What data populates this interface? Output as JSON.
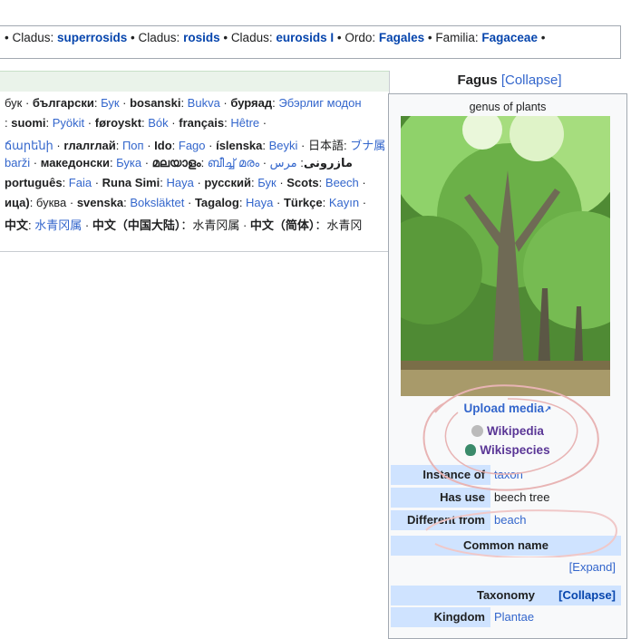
{
  "taxbar": {
    "items": [
      {
        "label": "Cladus",
        "value": "superrosids"
      },
      {
        "label": "Cladus",
        "value": "rosids"
      },
      {
        "label": "Cladus",
        "value": "eurosids I"
      },
      {
        "label": "Ordo",
        "value": "Fagales"
      },
      {
        "label": "Familia",
        "value": "Fagaceae"
      }
    ],
    "sep": " • ",
    "colon": ": "
  },
  "languages": {
    "lines": [
      [
        {
          "t": "бук",
          "c": "n"
        },
        {
          "t": " · ",
          "c": "n"
        },
        {
          "t": "български",
          "c": "b"
        },
        {
          "t": ": ",
          "c": "n"
        },
        {
          "t": "Бук",
          "c": "l"
        },
        {
          "t": " · ",
          "c": "n"
        },
        {
          "t": "bosanski",
          "c": "b"
        },
        {
          "t": ": ",
          "c": "n"
        },
        {
          "t": "Bukva",
          "c": "l"
        },
        {
          "t": " · ",
          "c": "n"
        },
        {
          "t": "буряад",
          "c": "b"
        },
        {
          "t": ": ",
          "c": "n"
        },
        {
          "t": "Эбэрлиг модон",
          "c": "l"
        }
      ],
      [
        {
          "t": ": ",
          "c": "n"
        },
        {
          "t": "suomi",
          "c": "b"
        },
        {
          "t": ": ",
          "c": "n"
        },
        {
          "t": "Pyökit",
          "c": "l"
        },
        {
          "t": " · ",
          "c": "n"
        },
        {
          "t": "føroyskt",
          "c": "b"
        },
        {
          "t": ": ",
          "c": "n"
        },
        {
          "t": "Bók",
          "c": "l"
        },
        {
          "t": " · ",
          "c": "n"
        },
        {
          "t": "français",
          "c": "b"
        },
        {
          "t": ": ",
          "c": "n"
        },
        {
          "t": "Hêtre",
          "c": "l"
        },
        {
          "t": " ·",
          "c": "n"
        }
      ],
      [
        {
          "t": "ճարենի",
          "c": "l"
        },
        {
          "t": " · ",
          "c": "n"
        },
        {
          "t": "rлaлrлай",
          "c": "b"
        },
        {
          "t": ": ",
          "c": "n"
        },
        {
          "t": "Поп",
          "c": "l"
        },
        {
          "t": " · ",
          "c": "n"
        },
        {
          "t": "Ido",
          "c": "b"
        },
        {
          "t": ": ",
          "c": "n"
        },
        {
          "t": "Fago",
          "c": "l"
        },
        {
          "t": " · ",
          "c": "n"
        },
        {
          "t": "íslenska",
          "c": "b"
        },
        {
          "t": ": ",
          "c": "n"
        },
        {
          "t": "Beyki",
          "c": "l"
        },
        {
          "t": " · ",
          "c": "n"
        },
        {
          "t": "日本語",
          "c": "n"
        },
        {
          "t": ": ",
          "c": "n"
        },
        {
          "t": "ブナ属",
          "c": "l"
        }
      ],
      [
        {
          "t": "barži",
          "c": "l"
        },
        {
          "t": " · ",
          "c": "n"
        },
        {
          "t": "македонски",
          "c": "b"
        },
        {
          "t": ": ",
          "c": "n"
        },
        {
          "t": "Бука",
          "c": "l"
        },
        {
          "t": " · ",
          "c": "n"
        },
        {
          "t": "മലയാളം",
          "c": "b"
        },
        {
          "t": ": ",
          "c": "n"
        },
        {
          "t": "ബീച്ച് മരം",
          "c": "l"
        },
        {
          "t": " · ",
          "c": "n"
        },
        {
          "t": "مازِرونی",
          "c": "b"
        },
        {
          "t": ": ",
          "c": "n"
        },
        {
          "t": "مرس",
          "c": "l"
        }
      ],
      [
        {
          "t": "português",
          "c": "b"
        },
        {
          "t": ": ",
          "c": "n"
        },
        {
          "t": "Faia",
          "c": "l"
        },
        {
          "t": " · ",
          "c": "n"
        },
        {
          "t": "Runa Simi",
          "c": "b"
        },
        {
          "t": ": ",
          "c": "n"
        },
        {
          "t": "Haya",
          "c": "l"
        },
        {
          "t": " · ",
          "c": "n"
        },
        {
          "t": "русский",
          "c": "b"
        },
        {
          "t": ": ",
          "c": "n"
        },
        {
          "t": "Бук",
          "c": "l"
        },
        {
          "t": " · ",
          "c": "n"
        },
        {
          "t": "Scots",
          "c": "b"
        },
        {
          "t": ": ",
          "c": "n"
        },
        {
          "t": "Beech",
          "c": "l"
        },
        {
          "t": " ·",
          "c": "n"
        }
      ],
      [
        {
          "t": "ица)",
          "c": "b"
        },
        {
          "t": ": буква · ",
          "c": "n"
        },
        {
          "t": "svenska",
          "c": "b"
        },
        {
          "t": ": ",
          "c": "n"
        },
        {
          "t": "Boksläktet",
          "c": "l"
        },
        {
          "t": " · ",
          "c": "n"
        },
        {
          "t": "Tagalog",
          "c": "b"
        },
        {
          "t": ": ",
          "c": "n"
        },
        {
          "t": "Haya",
          "c": "l"
        },
        {
          "t": " · ",
          "c": "n"
        },
        {
          "t": "Türkçe",
          "c": "b"
        },
        {
          "t": ": ",
          "c": "n"
        },
        {
          "t": "Kayın",
          "c": "l"
        },
        {
          "t": " ·",
          "c": "n"
        }
      ],
      [
        {
          "t": "中文",
          "c": "b"
        },
        {
          "t": ": ",
          "c": "n"
        },
        {
          "t": "水青冈属",
          "c": "l"
        },
        {
          "t": " · ",
          "c": "n"
        },
        {
          "t": "中文（中国大陆）",
          "c": "b"
        },
        {
          "t": "：水青冈属 · ",
          "c": "n"
        },
        {
          "t": "中文（简体）",
          "c": "b"
        },
        {
          "t": "：水青冈",
          "c": "n"
        }
      ]
    ]
  },
  "infobox": {
    "title": "Fagus",
    "collapse_label": "[Collapse]",
    "subtitle": "genus of plants",
    "upload_media": "Upload media",
    "wikipedia": "Wikipedia",
    "wikispecies": "Wikispecies",
    "instance_of_label": "Instance of",
    "instance_of_value": "taxon",
    "has_use_label": "Has use",
    "has_use_value": "beech tree",
    "different_from_label": "Different from",
    "different_from_value": "beach",
    "common_name_label": "Common name",
    "expand_label": "[Expand]",
    "taxonomy_label": "Taxonomy",
    "taxonomy_collapse": "[Collapse]",
    "kingdom_label": "Kingdom",
    "kingdom_value": "Plantae"
  },
  "colors": {
    "link": "#3366cc",
    "dark_link": "#0645ad",
    "header_blue": "#cfe3ff",
    "annotation": "#e8b4b4"
  }
}
